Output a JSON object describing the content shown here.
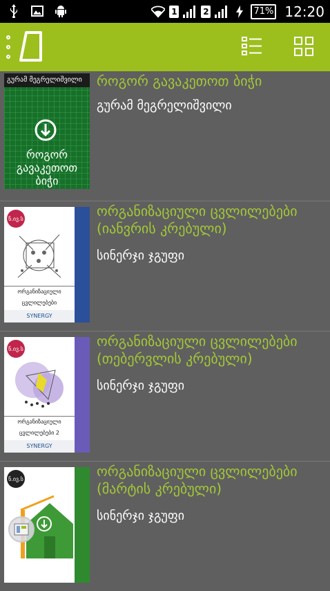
{
  "status_bar": {
    "sim1": "1",
    "sim2": "2",
    "battery": "71%",
    "time": "12:20",
    "icons": [
      "usb-icon",
      "image-icon",
      "android-icon",
      "wifi-icon",
      "signal-icon",
      "charging-icon"
    ]
  },
  "app_bar": {
    "accent": "#9cbf1e",
    "icons": [
      "overflow-menu-icon",
      "app-logo-icon",
      "list-view-icon",
      "grid-view-icon"
    ]
  },
  "books": [
    {
      "title": "როგორ გავაკეთოთ ბიჭი",
      "author": "გურამ მეგრელიშვილი",
      "cover_band": "გურამ მეგრელიშვილი",
      "cover_title": "როგორ გავაკეთოთ ბიჭი"
    },
    {
      "title": "ორგანიზაციული ცვლილებები (იანვრის კრებული)",
      "author": "სინერჯი ჯგუფი",
      "cover_badge": "ნ.ივ.ს",
      "cover_bottom": "ორგანიზაციული ცვლილებები"
    },
    {
      "title": "ორგანიზაციული ცვლილებები (თებერვლის კრებული)",
      "author": "სინერჯი ჯგუფი",
      "cover_badge": "ნ.ივ.ს",
      "cover_bottom": "ორგანიზაციული ცვლილებები 2"
    },
    {
      "title": "ორგანიზაციული ცვლილებები (მარტის კრებული)",
      "author": "სინერჯი ჯგუფი",
      "cover_badge": "ნ.ივ.ს"
    }
  ]
}
